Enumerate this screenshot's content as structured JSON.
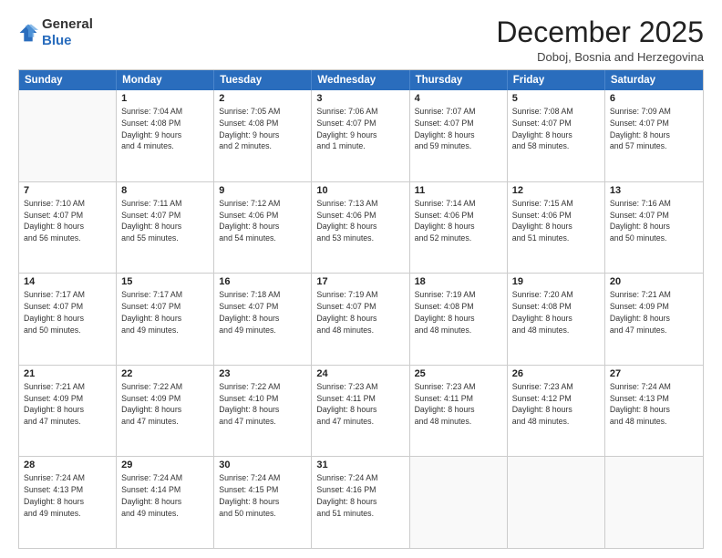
{
  "logo": {
    "general": "General",
    "blue": "Blue"
  },
  "header": {
    "month": "December 2025",
    "location": "Doboj, Bosnia and Herzegovina"
  },
  "weekdays": [
    "Sunday",
    "Monday",
    "Tuesday",
    "Wednesday",
    "Thursday",
    "Friday",
    "Saturday"
  ],
  "rows": [
    [
      {
        "date": "",
        "info": ""
      },
      {
        "date": "1",
        "info": "Sunrise: 7:04 AM\nSunset: 4:08 PM\nDaylight: 9 hours\nand 4 minutes."
      },
      {
        "date": "2",
        "info": "Sunrise: 7:05 AM\nSunset: 4:08 PM\nDaylight: 9 hours\nand 2 minutes."
      },
      {
        "date": "3",
        "info": "Sunrise: 7:06 AM\nSunset: 4:07 PM\nDaylight: 9 hours\nand 1 minute."
      },
      {
        "date": "4",
        "info": "Sunrise: 7:07 AM\nSunset: 4:07 PM\nDaylight: 8 hours\nand 59 minutes."
      },
      {
        "date": "5",
        "info": "Sunrise: 7:08 AM\nSunset: 4:07 PM\nDaylight: 8 hours\nand 58 minutes."
      },
      {
        "date": "6",
        "info": "Sunrise: 7:09 AM\nSunset: 4:07 PM\nDaylight: 8 hours\nand 57 minutes."
      }
    ],
    [
      {
        "date": "7",
        "info": "Sunrise: 7:10 AM\nSunset: 4:07 PM\nDaylight: 8 hours\nand 56 minutes."
      },
      {
        "date": "8",
        "info": "Sunrise: 7:11 AM\nSunset: 4:07 PM\nDaylight: 8 hours\nand 55 minutes."
      },
      {
        "date": "9",
        "info": "Sunrise: 7:12 AM\nSunset: 4:06 PM\nDaylight: 8 hours\nand 54 minutes."
      },
      {
        "date": "10",
        "info": "Sunrise: 7:13 AM\nSunset: 4:06 PM\nDaylight: 8 hours\nand 53 minutes."
      },
      {
        "date": "11",
        "info": "Sunrise: 7:14 AM\nSunset: 4:06 PM\nDaylight: 8 hours\nand 52 minutes."
      },
      {
        "date": "12",
        "info": "Sunrise: 7:15 AM\nSunset: 4:06 PM\nDaylight: 8 hours\nand 51 minutes."
      },
      {
        "date": "13",
        "info": "Sunrise: 7:16 AM\nSunset: 4:07 PM\nDaylight: 8 hours\nand 50 minutes."
      }
    ],
    [
      {
        "date": "14",
        "info": "Sunrise: 7:17 AM\nSunset: 4:07 PM\nDaylight: 8 hours\nand 50 minutes."
      },
      {
        "date": "15",
        "info": "Sunrise: 7:17 AM\nSunset: 4:07 PM\nDaylight: 8 hours\nand 49 minutes."
      },
      {
        "date": "16",
        "info": "Sunrise: 7:18 AM\nSunset: 4:07 PM\nDaylight: 8 hours\nand 49 minutes."
      },
      {
        "date": "17",
        "info": "Sunrise: 7:19 AM\nSunset: 4:07 PM\nDaylight: 8 hours\nand 48 minutes."
      },
      {
        "date": "18",
        "info": "Sunrise: 7:19 AM\nSunset: 4:08 PM\nDaylight: 8 hours\nand 48 minutes."
      },
      {
        "date": "19",
        "info": "Sunrise: 7:20 AM\nSunset: 4:08 PM\nDaylight: 8 hours\nand 48 minutes."
      },
      {
        "date": "20",
        "info": "Sunrise: 7:21 AM\nSunset: 4:09 PM\nDaylight: 8 hours\nand 47 minutes."
      }
    ],
    [
      {
        "date": "21",
        "info": "Sunrise: 7:21 AM\nSunset: 4:09 PM\nDaylight: 8 hours\nand 47 minutes."
      },
      {
        "date": "22",
        "info": "Sunrise: 7:22 AM\nSunset: 4:09 PM\nDaylight: 8 hours\nand 47 minutes."
      },
      {
        "date": "23",
        "info": "Sunrise: 7:22 AM\nSunset: 4:10 PM\nDaylight: 8 hours\nand 47 minutes."
      },
      {
        "date": "24",
        "info": "Sunrise: 7:23 AM\nSunset: 4:11 PM\nDaylight: 8 hours\nand 47 minutes."
      },
      {
        "date": "25",
        "info": "Sunrise: 7:23 AM\nSunset: 4:11 PM\nDaylight: 8 hours\nand 48 minutes."
      },
      {
        "date": "26",
        "info": "Sunrise: 7:23 AM\nSunset: 4:12 PM\nDaylight: 8 hours\nand 48 minutes."
      },
      {
        "date": "27",
        "info": "Sunrise: 7:24 AM\nSunset: 4:13 PM\nDaylight: 8 hours\nand 48 minutes."
      }
    ],
    [
      {
        "date": "28",
        "info": "Sunrise: 7:24 AM\nSunset: 4:13 PM\nDaylight: 8 hours\nand 49 minutes."
      },
      {
        "date": "29",
        "info": "Sunrise: 7:24 AM\nSunset: 4:14 PM\nDaylight: 8 hours\nand 49 minutes."
      },
      {
        "date": "30",
        "info": "Sunrise: 7:24 AM\nSunset: 4:15 PM\nDaylight: 8 hours\nand 50 minutes."
      },
      {
        "date": "31",
        "info": "Sunrise: 7:24 AM\nSunset: 4:16 PM\nDaylight: 8 hours\nand 51 minutes."
      },
      {
        "date": "",
        "info": ""
      },
      {
        "date": "",
        "info": ""
      },
      {
        "date": "",
        "info": ""
      }
    ]
  ]
}
